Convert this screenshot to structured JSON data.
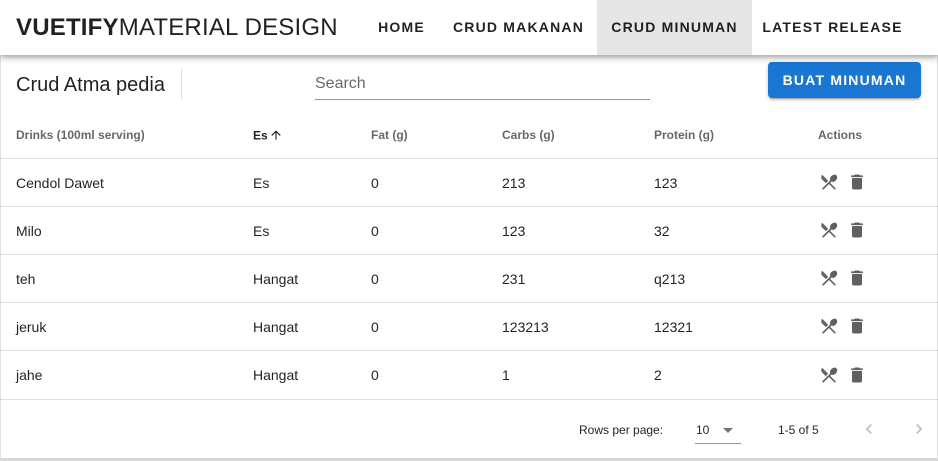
{
  "app": {
    "brand_bold": "VUETIFY",
    "brand_light": "MATERIAL DESIGN"
  },
  "nav": {
    "items": [
      {
        "label": "HOME",
        "active": false
      },
      {
        "label": "CRUD MAKANAN",
        "active": false
      },
      {
        "label": "CRUD MINUMAN",
        "active": true
      },
      {
        "label": "LATEST RELEASE",
        "active": false
      }
    ]
  },
  "card": {
    "title": "Crud Atma pedia",
    "search_placeholder": "Search",
    "search_value": "",
    "create_button": "BUAT MINUMAN"
  },
  "table": {
    "headers": [
      "Drinks (100ml serving)",
      "Es",
      "Fat (g)",
      "Carbs (g)",
      "Protein (g)",
      "Actions"
    ],
    "sorted_column": "Es",
    "sort_icon": "arrow-up-icon",
    "rows": [
      {
        "name": "Cendol Dawet",
        "es": "Es",
        "fat": "0",
        "carbs": "213",
        "protein": "123"
      },
      {
        "name": "Milo",
        "es": "Es",
        "fat": "0",
        "carbs": "123",
        "protein": "32"
      },
      {
        "name": "teh",
        "es": "Hangat",
        "fat": "0",
        "carbs": "231",
        "protein": "q213"
      },
      {
        "name": "jeruk",
        "es": "Hangat",
        "fat": "0",
        "carbs": "123213",
        "protein": "12321"
      },
      {
        "name": "jahe",
        "es": "Hangat",
        "fat": "0",
        "carbs": "1",
        "protein": "2"
      }
    ],
    "action_icons": [
      "fork-knife-icon",
      "trash-icon"
    ]
  },
  "footer": {
    "rows_per_page_label": "Rows per page:",
    "rows_per_page_value": "10",
    "page_range": "1-5 of 5"
  },
  "colors": {
    "primary": "#1976d2",
    "active_nav_bg": "#e6e6e6",
    "icon_gray": "#616161"
  }
}
